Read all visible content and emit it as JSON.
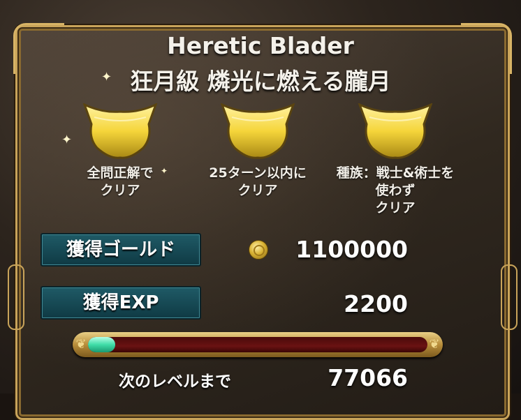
{
  "stage": {
    "title": "Heretic Blader",
    "subtitle": "狂月級 燐光に燃える朧月"
  },
  "missions": [
    {
      "line1": "全問正解で",
      "line2": "クリア",
      "line3": ""
    },
    {
      "line1": "25ターン以内に",
      "line2": "クリア",
      "line3": ""
    },
    {
      "line1": "種族：戦士&術士を",
      "line2": "使わず",
      "line3": "クリア"
    }
  ],
  "rewards": {
    "gold_label": "獲得ゴールド",
    "gold_value": "1100000",
    "exp_label": "獲得EXP",
    "exp_value": "2200"
  },
  "level": {
    "next_label": "次のレベルまで",
    "next_value": "77066",
    "progress_fraction": 0.08
  },
  "colors": {
    "crest_gold": "#f5d53a",
    "label_teal": "#1f5a66",
    "bar_fill": "#3fdca8",
    "bar_track": "#6a1212"
  },
  "icons": [
    "sparkle-icon",
    "crest-icon",
    "gold-coin-icon"
  ]
}
